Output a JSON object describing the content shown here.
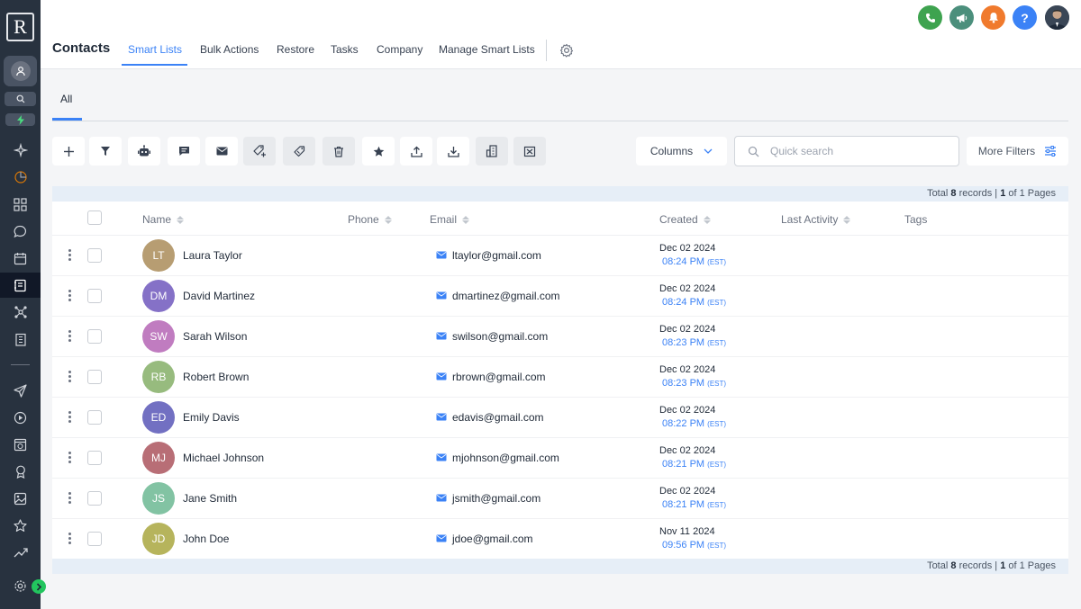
{
  "app": {
    "logo_letter": "R"
  },
  "sidebar": {
    "icons": [
      "account-icon",
      "search-icon",
      "bolt-icon",
      "sparkle-icon",
      "dashboard-chart-icon",
      "grid-icon",
      "chat-icon",
      "calendar-icon",
      "contacts-icon",
      "workflow-icon",
      "building-icon",
      "send-icon",
      "play-icon",
      "website-icon",
      "award-icon",
      "media-icon",
      "star-icon",
      "trending-icon",
      "settings-icon"
    ]
  },
  "header": {
    "title": "Contacts",
    "tabs": [
      {
        "label": "Smart Lists"
      },
      {
        "label": "Bulk Actions"
      },
      {
        "label": "Restore"
      },
      {
        "label": "Tasks"
      },
      {
        "label": "Company"
      },
      {
        "label": "Manage Smart Lists"
      }
    ],
    "top_buttons": [
      {
        "name": "phone-icon",
        "color": "#3ea34f"
      },
      {
        "name": "megaphone-icon",
        "color": "#4b8f7c"
      },
      {
        "name": "bell-icon",
        "color": "#f07a2d"
      },
      {
        "name": "help-icon",
        "color": "#3b82f6"
      }
    ]
  },
  "subtabs": [
    {
      "label": "All"
    }
  ],
  "toolbar": {
    "columns_label": "Columns",
    "search_placeholder": "Quick search",
    "more_filters_label": "More Filters"
  },
  "totals": {
    "prefix": "Total",
    "count": "8",
    "records_label": "records |",
    "page": "1",
    "of_pages": "of 1 Pages"
  },
  "table": {
    "columns": [
      "Name",
      "Phone",
      "Email",
      "Created",
      "Last Activity",
      "Tags"
    ],
    "rows": [
      {
        "initials": "LT",
        "color": "#b79d72",
        "name": "Laura Taylor",
        "email": "ltaylor@gmail.com",
        "date": "Dec 02 2024",
        "time": "08:24 PM",
        "tz": "(EST)"
      },
      {
        "initials": "DM",
        "color": "#8571c7",
        "name": "David Martinez",
        "email": "dmartinez@gmail.com",
        "date": "Dec 02 2024",
        "time": "08:24 PM",
        "tz": "(EST)"
      },
      {
        "initials": "SW",
        "color": "#c07cc0",
        "name": "Sarah Wilson",
        "email": "swilson@gmail.com",
        "date": "Dec 02 2024",
        "time": "08:23 PM",
        "tz": "(EST)"
      },
      {
        "initials": "RB",
        "color": "#97bb7e",
        "name": "Robert Brown",
        "email": "rbrown@gmail.com",
        "date": "Dec 02 2024",
        "time": "08:23 PM",
        "tz": "(EST)"
      },
      {
        "initials": "ED",
        "color": "#7270c2",
        "name": "Emily Davis",
        "email": "edavis@gmail.com",
        "date": "Dec 02 2024",
        "time": "08:22 PM",
        "tz": "(EST)"
      },
      {
        "initials": "MJ",
        "color": "#b86e76",
        "name": "Michael Johnson",
        "email": "mjohnson@gmail.com",
        "date": "Dec 02 2024",
        "time": "08:21 PM",
        "tz": "(EST)"
      },
      {
        "initials": "JS",
        "color": "#82c3a3",
        "name": "Jane Smith",
        "email": "jsmith@gmail.com",
        "date": "Dec 02 2024",
        "time": "08:21 PM",
        "tz": "(EST)"
      },
      {
        "initials": "JD",
        "color": "#b6b45c",
        "name": "John Doe",
        "email": "jdoe@gmail.com",
        "date": "Nov 11 2024",
        "time": "09:56 PM",
        "tz": "(EST)"
      }
    ]
  }
}
